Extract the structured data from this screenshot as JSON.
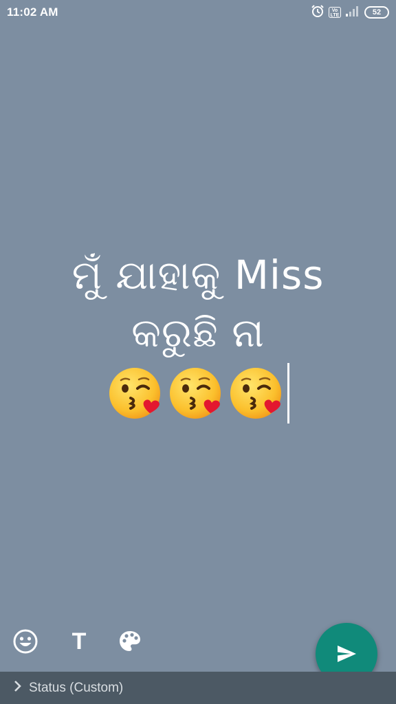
{
  "status_bar": {
    "time": "11:02 AM",
    "network_badge": "Vo LTE",
    "battery": "52",
    "icons": [
      "alarm-icon",
      "volte-icon",
      "signal-icon",
      "battery-icon"
    ]
  },
  "composer": {
    "status_lines": [
      "ମୁଁ ଯାହାକୁ Miss",
      "କରୁଛି ନା"
    ],
    "emoji_count": 3,
    "emoji_name": "face-blowing-a-kiss",
    "background_color": "#7d8ea1"
  },
  "toolbar": {
    "emoji_icon": "smiley-icon",
    "text_label": "T",
    "color_icon": "palette-icon"
  },
  "send_button": {
    "icon": "send-icon",
    "color": "#108a7a"
  },
  "bottom_bar": {
    "label": "Status (Custom)",
    "icon": "chevron-right-icon"
  }
}
